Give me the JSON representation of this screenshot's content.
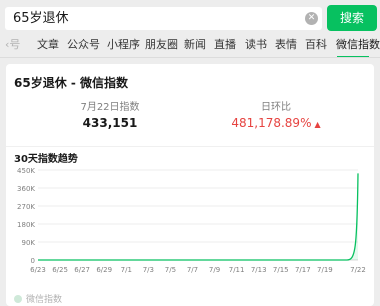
{
  "search": {
    "query": "65岁退休",
    "button_label": "搜索"
  },
  "tabs": [
    {
      "label": "号",
      "active": false
    },
    {
      "label": "文章",
      "active": false
    },
    {
      "label": "公众号",
      "active": false
    },
    {
      "label": "小程序",
      "active": false
    },
    {
      "label": "朋友圈",
      "active": false
    },
    {
      "label": "新闻",
      "active": false
    },
    {
      "label": "直播",
      "active": false
    },
    {
      "label": "读书",
      "active": false
    },
    {
      "label": "表情",
      "active": false
    },
    {
      "label": "百科",
      "active": false
    },
    {
      "label": "微信指数",
      "active": true
    }
  ],
  "card": {
    "title": "65岁退休 - 微信指数",
    "metrics": {
      "daily_label": "7月22日指数",
      "daily_value": "433,151",
      "ratio_label": "日环比",
      "ratio_value": "481,178.89%"
    },
    "trend_title": "30天指数趋势",
    "source": "微信指数"
  },
  "colors": {
    "accent": "#07c160",
    "up": "#e64340"
  },
  "chart_data": {
    "type": "line",
    "title": "30天指数趋势",
    "xlabel": "",
    "ylabel": "",
    "ylim": [
      0,
      450000
    ],
    "y_ticks": [
      "0",
      "90K",
      "180K",
      "270K",
      "360K",
      "450K"
    ],
    "x_tick_labels": [
      "6/23",
      "6/25",
      "6/27",
      "6/29",
      "7/1",
      "7/3",
      "7/5",
      "7/7",
      "7/9",
      "7/11",
      "7/13",
      "7/15",
      "7/17",
      "7/19",
      "7/22"
    ],
    "x": [
      "6/23",
      "6/24",
      "6/25",
      "6/26",
      "6/27",
      "6/28",
      "6/29",
      "6/30",
      "7/1",
      "7/2",
      "7/3",
      "7/4",
      "7/5",
      "7/6",
      "7/7",
      "7/8",
      "7/9",
      "7/10",
      "7/11",
      "7/12",
      "7/13",
      "7/14",
      "7/15",
      "7/16",
      "7/17",
      "7/18",
      "7/19",
      "7/20",
      "7/21",
      "7/22"
    ],
    "series": [
      {
        "values": [
          90,
          90,
          90,
          90,
          90,
          90,
          90,
          90,
          90,
          90,
          90,
          90,
          90,
          90,
          90,
          90,
          90,
          90,
          90,
          90,
          90,
          90,
          90,
          90,
          90,
          90,
          90,
          90,
          90,
          433151
        ]
      }
    ],
    "grid": true
  }
}
